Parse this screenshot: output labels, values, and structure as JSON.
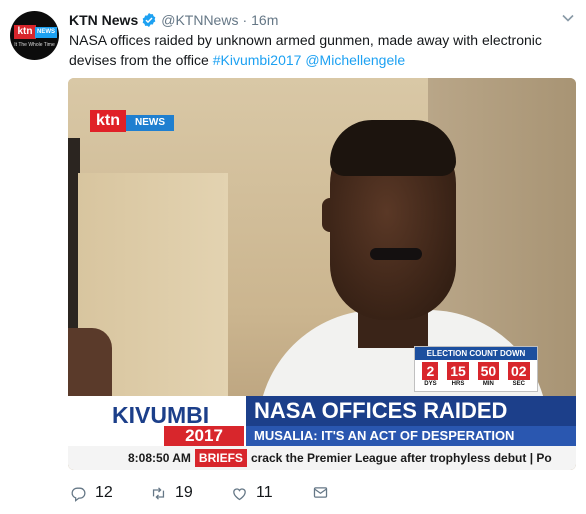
{
  "tweet": {
    "author_name": "KTN News",
    "author_handle": "@KTNNews",
    "separator": "·",
    "time": "16m",
    "text_plain": "NASA offices raided by unknown armed gunmen, made away with electronic devises from the office ",
    "hashtag": "#Kivumbi2017",
    "mention": "@Michellengele",
    "avatar": {
      "logo_red": "ktn",
      "logo_blue": "NEWS",
      "logo_sub": "It The Whole Time"
    }
  },
  "media": {
    "channel_logo_red": "ktn",
    "channel_logo_blue": "NEWS",
    "countdown": {
      "title": "ELECTION COUNT DOWN",
      "cells": [
        {
          "num": "2",
          "unit": "DYS"
        },
        {
          "num": "15",
          "unit": "HRS"
        },
        {
          "num": "50",
          "unit": "MIN"
        },
        {
          "num": "02",
          "unit": "SEC"
        }
      ]
    },
    "lower_third": {
      "kivumbi": "KIVUMBI",
      "year": "2017",
      "headline": "NASA OFFICES RAIDED",
      "subheadline": "MUSALIA: IT'S AN ACT OF DESPERATION"
    },
    "ticker": {
      "time": "8:08:50 AM",
      "label": "BRIEFS",
      "text": "crack the Premier League after trophyless debut | Po"
    }
  },
  "actions": {
    "reply_count": "12",
    "retweet_count": "19",
    "like_count": "11"
  },
  "colors": {
    "link": "#1da1f2",
    "verified": "#1da1f2",
    "muted": "#657786"
  },
  "icons": [
    "verified-badge-icon",
    "caret-down-icon",
    "reply-icon",
    "retweet-icon",
    "like-icon",
    "direct-message-icon"
  ]
}
